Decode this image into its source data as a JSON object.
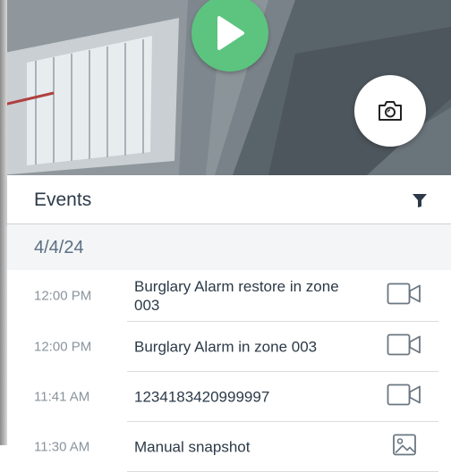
{
  "player": {
    "play_icon": "play-icon",
    "snapshot_icon": "camera-icon",
    "accent_color": "#5cc47f"
  },
  "events_panel": {
    "title": "Events",
    "filter_icon": "filter-icon"
  },
  "date_group": {
    "date": "4/4/24"
  },
  "events": [
    {
      "time": "12:00 PM",
      "description": "Burglary Alarm restore in zone 003",
      "icon": "video-clip-icon"
    },
    {
      "time": "12:00 PM",
      "description": "Burglary Alarm in zone 003",
      "icon": "video-clip-icon"
    },
    {
      "time": "11:41 AM",
      "description": "1234183420999997",
      "icon": "video-clip-icon"
    },
    {
      "time": "11:30 AM",
      "description": "Manual snapshot",
      "icon": "image-icon"
    }
  ]
}
